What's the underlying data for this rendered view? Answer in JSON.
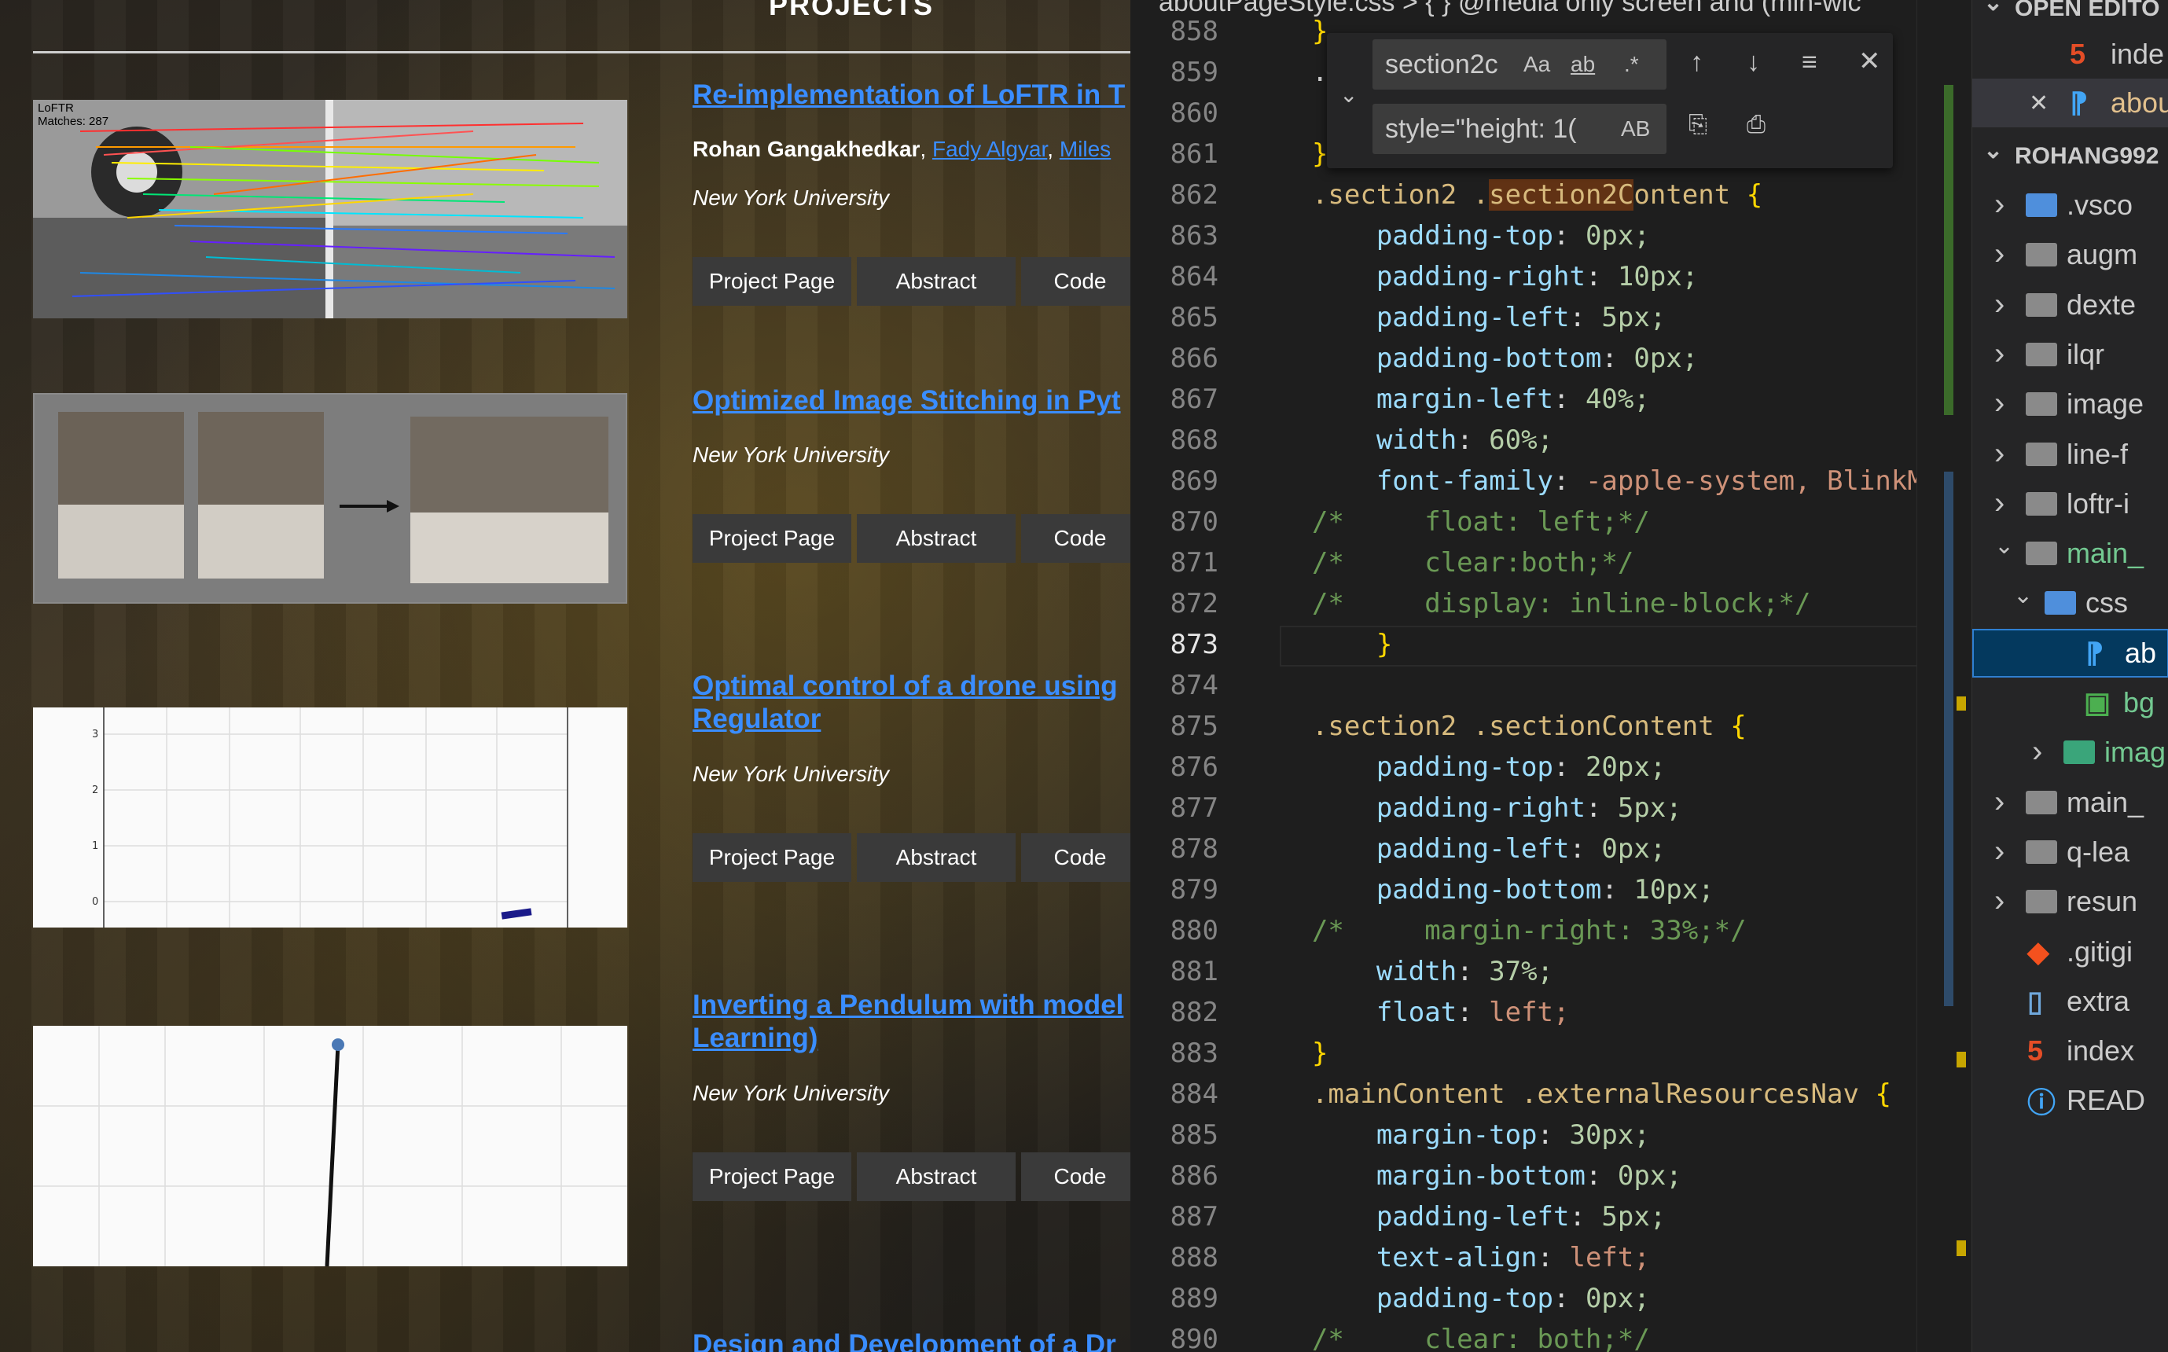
{
  "site": {
    "heading": "PROJECTS",
    "projects": [
      {
        "title": "Re-implementation of LoFTR in T",
        "authors_me": "Rohan Gangakhedkar",
        "authors_links": [
          "Fady Algyar",
          "Miles"
        ],
        "institution": "New York University",
        "thumb_caption_1": "LoFTR",
        "thumb_caption_2": "Matches: 287",
        "buttons": [
          "Project Page",
          "Abstract",
          "Code"
        ]
      },
      {
        "title": "Optimized Image Stitching in Pyt",
        "institution": "New York University",
        "buttons": [
          "Project Page",
          "Abstract",
          "Code"
        ]
      },
      {
        "title_line1": "Optimal control of a drone using",
        "title_line2": "Regulator",
        "institution": "New York University",
        "plot_ticks": [
          "3",
          "2",
          "1",
          "0"
        ],
        "buttons": [
          "Project Page",
          "Abstract",
          "Code"
        ]
      },
      {
        "title_line1": "Inverting a Pendulum with model",
        "title_line2": "Learning)",
        "institution": "New York University",
        "buttons": [
          "Project Page",
          "Abstract",
          "Code"
        ]
      },
      {
        "title": "Design and Development of a Dr"
      }
    ]
  },
  "editor": {
    "breadcrumb": "aboutPageStyle.css > { } @media only screen and (min-wic",
    "find": {
      "search_value": "section2c",
      "replace_value": "style=\"height: 1(",
      "opt_case": "Aa",
      "opt_word": "ab",
      "opt_regex": ".*",
      "opt_preserve": "AB"
    },
    "lines": [
      {
        "n": "858",
        "t": "  }"
      },
      {
        "n": "859",
        "t": "  .ma"
      },
      {
        "n": "860",
        "t": ""
      },
      {
        "n": "861",
        "t": "  }"
      },
      {
        "n": "862",
        "t": "  .section2 .section2Content {"
      },
      {
        "n": "863",
        "t": "      padding-top: 0px;"
      },
      {
        "n": "864",
        "t": "      padding-right: 10px;"
      },
      {
        "n": "865",
        "t": "      padding-left: 5px;"
      },
      {
        "n": "866",
        "t": "      padding-bottom: 0px;"
      },
      {
        "n": "867",
        "t": "      margin-left: 40%;"
      },
      {
        "n": "868",
        "t": "      width: 60%;"
      },
      {
        "n": "869",
        "t": "      font-family: -apple-system, BlinkMacSy"
      },
      {
        "n": "870",
        "t": "  /*     float: left;*/"
      },
      {
        "n": "871",
        "t": "  /*     clear:both;*/"
      },
      {
        "n": "872",
        "t": "  /*     display: inline-block;*/"
      },
      {
        "n": "873",
        "t": "      }"
      },
      {
        "n": "874",
        "t": ""
      },
      {
        "n": "875",
        "t": "  .section2 .sectionContent {"
      },
      {
        "n": "876",
        "t": "      padding-top: 20px;"
      },
      {
        "n": "877",
        "t": "      padding-right: 5px;"
      },
      {
        "n": "878",
        "t": "      padding-left: 0px;"
      },
      {
        "n": "879",
        "t": "      padding-bottom: 10px;"
      },
      {
        "n": "880",
        "t": "  /*     margin-right: 33%;*/"
      },
      {
        "n": "881",
        "t": "      width: 37%;"
      },
      {
        "n": "882",
        "t": "      float: left;"
      },
      {
        "n": "883",
        "t": "  }"
      },
      {
        "n": "884",
        "t": "  .mainContent .externalResourcesNav {"
      },
      {
        "n": "885",
        "t": "      margin-top: 30px;"
      },
      {
        "n": "886",
        "t": "      margin-bottom: 0px;"
      },
      {
        "n": "887",
        "t": "      padding-left: 5px;"
      },
      {
        "n": "888",
        "t": "      text-align: left;"
      },
      {
        "n": "889",
        "t": "      padding-top: 0px;"
      },
      {
        "n": "890",
        "t": "  /*     clear: both;*/"
      }
    ],
    "current_line": "873"
  },
  "explorer": {
    "open_editors_header": "OPEN EDITO",
    "open_editors": [
      "inde",
      "abou"
    ],
    "repo_header": "ROHANG992",
    "items": [
      {
        "label": ".vsco",
        "icon": "vscode-folder-icon"
      },
      {
        "label": "augm",
        "icon": "folder-icon"
      },
      {
        "label": "dexte",
        "icon": "folder-icon"
      },
      {
        "label": "ilqr",
        "icon": "folder-icon"
      },
      {
        "label": "image",
        "icon": "folder-icon"
      },
      {
        "label": "line-f",
        "icon": "folder-icon"
      },
      {
        "label": "loftr-i",
        "icon": "folder-icon"
      },
      {
        "label": "main_",
        "icon": "folder-open-icon"
      },
      {
        "label": "css",
        "icon": "css-folder-icon"
      },
      {
        "label": "ab",
        "icon": "css-file-icon"
      },
      {
        "label": "bg",
        "icon": "image-file-icon"
      },
      {
        "label": "imag",
        "icon": "image-folder-icon"
      },
      {
        "label": "main_",
        "icon": "folder-icon"
      },
      {
        "label": "q-lea",
        "icon": "folder-icon"
      },
      {
        "label": "resun",
        "icon": "folder-icon"
      },
      {
        "label": ".gitigi",
        "icon": "git-icon"
      },
      {
        "label": "extra",
        "icon": "file-icon"
      },
      {
        "label": "index",
        "icon": "html-file-icon"
      },
      {
        "label": "READ",
        "icon": "info-icon"
      }
    ]
  }
}
